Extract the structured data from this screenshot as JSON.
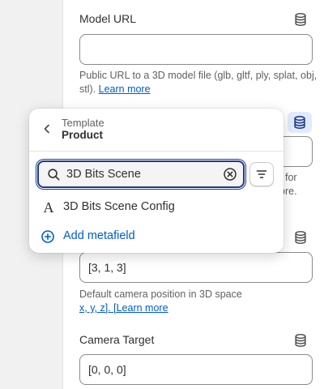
{
  "fields": {
    "model_url": {
      "label": "Model URL",
      "value": "",
      "help": "Public URL to a 3D model file (glb, gltf, ply, splat, obj, stl).",
      "help_line1": "Public URL to a 3D model file (glb, gltf, ply, splat, obj,",
      "help_line2": "stl).",
      "learn_more": "Learn more"
    },
    "hidden_field": {
      "help_fragment_1": "for",
      "help_fragment_2": "ore."
    },
    "camera_position": {
      "value": "[3, 1, 3]",
      "help_line1": "Default camera position in 3D space",
      "help_link": "x, y, z]. [Learn more"
    },
    "camera_target": {
      "label": "Camera Target",
      "value": "[0, 0, 0]"
    }
  },
  "popover": {
    "kicker": "Template",
    "title": "Product",
    "search": {
      "value": "3D Bits Scene",
      "placeholder": "Search"
    },
    "options": [
      {
        "icon": "text-type-icon",
        "glyph": "A",
        "label": "3D Bits Scene Config"
      }
    ],
    "add_metafield": "Add metafield"
  },
  "icons": {
    "database": "database-icon",
    "back": "chevron-left-icon",
    "search": "search-icon",
    "clear": "clear-circle-icon",
    "filter": "filter-lines-icon",
    "add": "plus-circle-icon"
  },
  "colors": {
    "link": "#005bd3",
    "focus_ring": "#1f3a8a",
    "active_db_bg": "#e0ebff",
    "active_db_icon": "#1f3a8a",
    "text": "#303030",
    "muted": "#616161"
  }
}
